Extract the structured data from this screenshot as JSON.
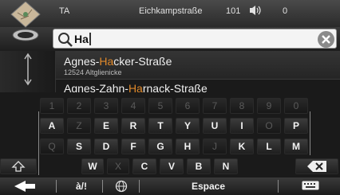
{
  "status": {
    "label": "TA",
    "street": "Eichkampstraße",
    "speed": "101",
    "volume": "0"
  },
  "search": {
    "value": "Ha"
  },
  "results": [
    {
      "pre": "Agnes-",
      "hl": "Ha",
      "post": "cker-Straße",
      "sub": "12524 Altglienicke"
    },
    {
      "pre": "Agnes-Zahn-",
      "hl": "Ha",
      "post": "rnack-Straße",
      "sub": ""
    }
  ],
  "keyboard": {
    "row1": [
      "1",
      "2",
      "3",
      "4",
      "5",
      "6",
      "7",
      "8",
      "9",
      "0"
    ],
    "row2": [
      "A",
      "Z",
      "E",
      "R",
      "T",
      "Y",
      "U",
      "I",
      "O",
      "P"
    ],
    "row3": [
      "Q",
      "S",
      "D",
      "F",
      "G",
      "H",
      "J",
      "K",
      "L",
      "M"
    ],
    "row4": [
      "W",
      "X",
      "C",
      "V",
      "B",
      "N"
    ],
    "bottom": {
      "special": "à/!",
      "space": "Espace"
    }
  },
  "colors": {
    "highlight": "#e0892a"
  }
}
